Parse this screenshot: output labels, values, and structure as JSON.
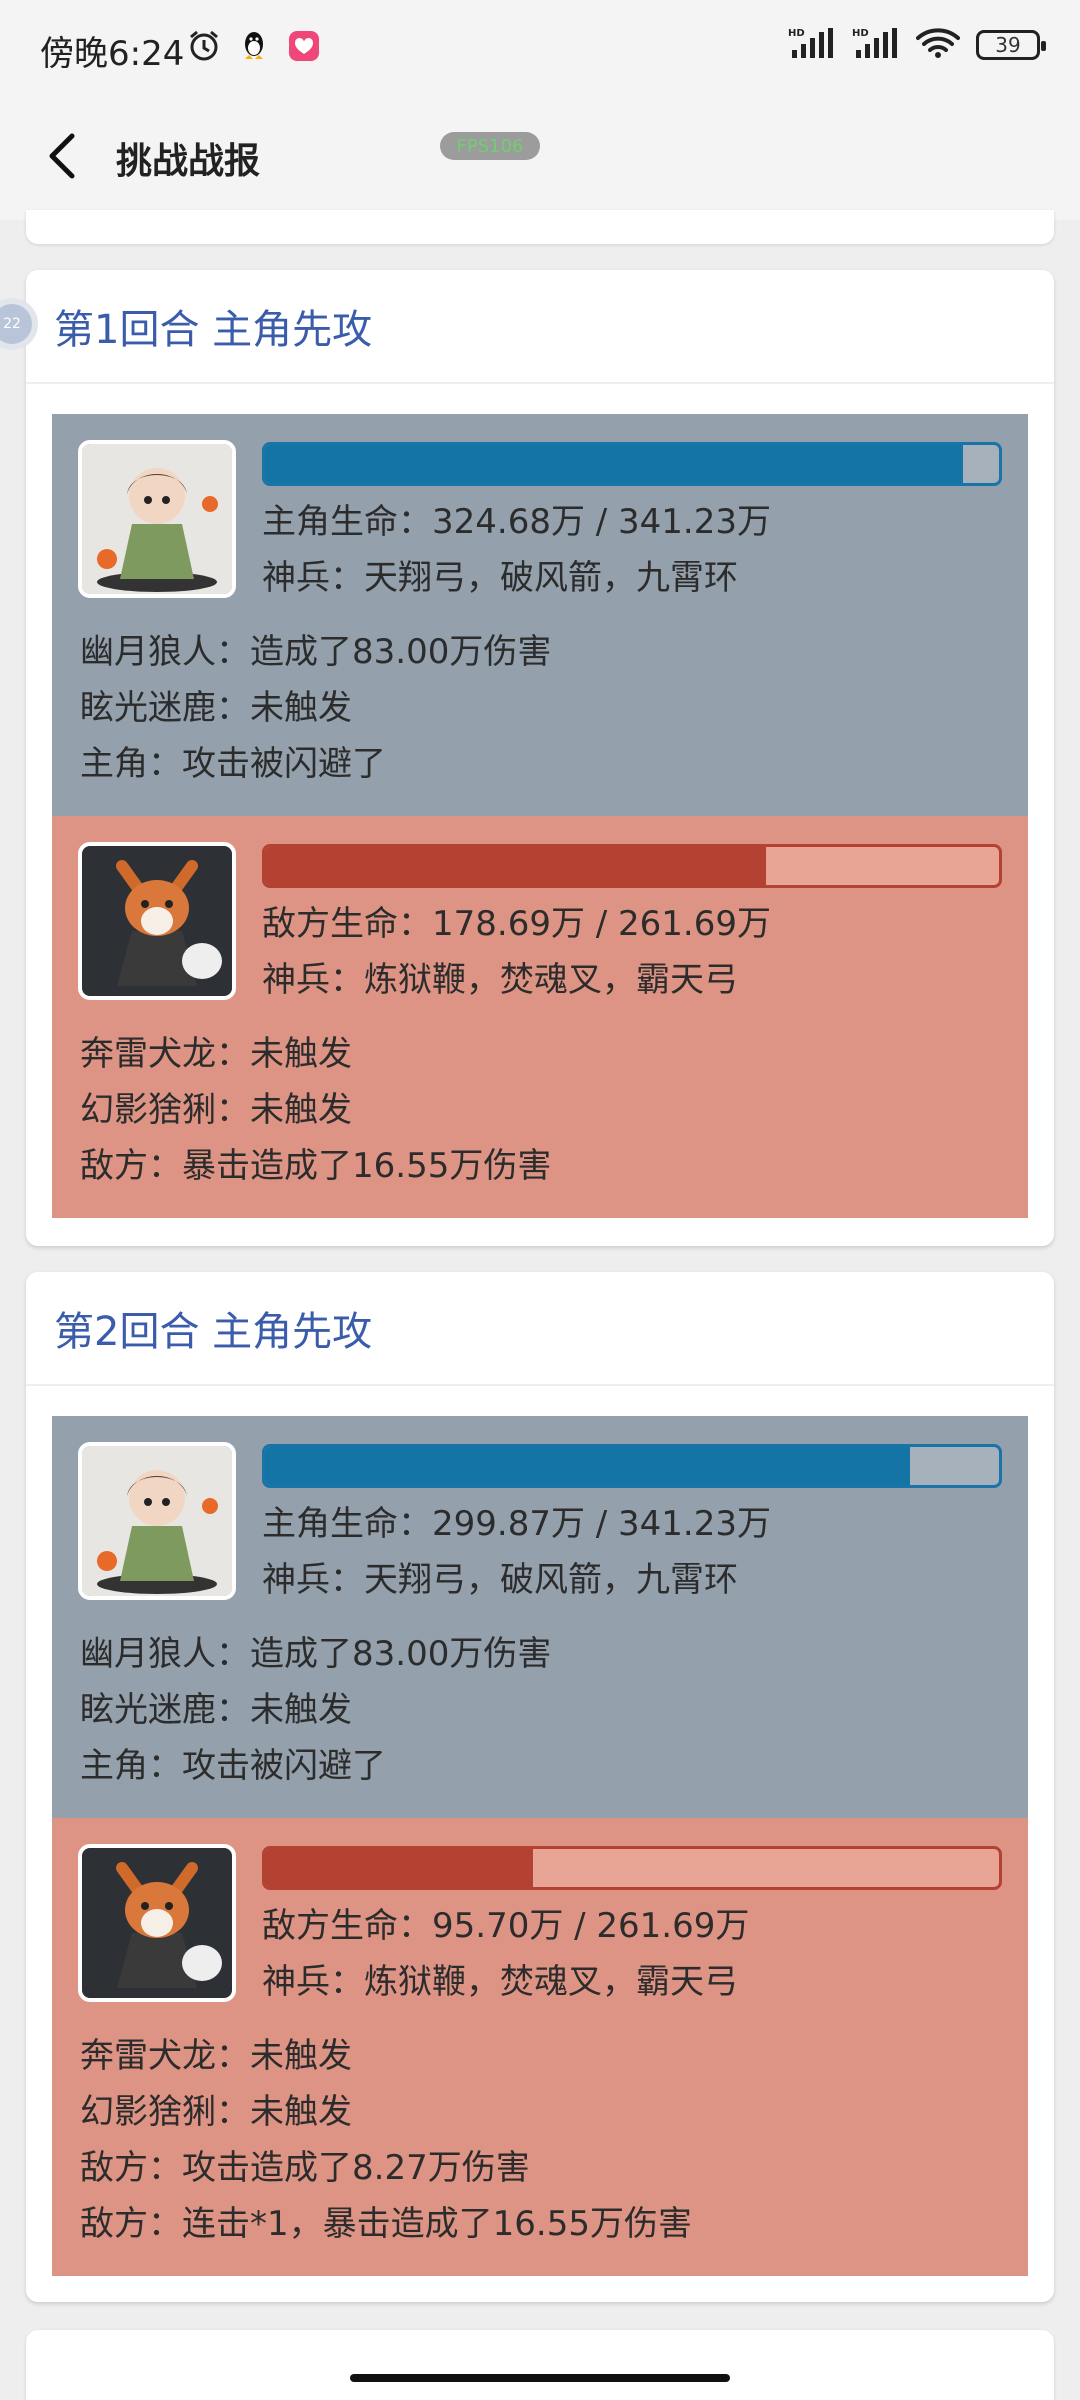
{
  "status_bar": {
    "time": "傍晚6:24",
    "battery": "39"
  },
  "header": {
    "title": "挑战战报",
    "fps_label": "FPS106"
  },
  "side_badge": "22",
  "rounds": [
    {
      "title": "第1回合 主角先攻",
      "hero": {
        "hp_text": "主角生命：324.68万 / 341.23万",
        "hp_fraction": 0.9515,
        "weapons": "神兵：天翔弓，破风箭，九霄环",
        "lines": [
          "幽月狼人：造成了83.00万伤害",
          "眩光迷鹿：未触发",
          "主角：攻击被闪避了"
        ]
      },
      "enemy": {
        "hp_text": "敌方生命：178.69万 / 261.69万",
        "hp_fraction": 0.6828,
        "weapons": "神兵：炼狱鞭，焚魂叉，霸天弓",
        "lines": [
          "奔雷犬龙：未触发",
          "幻影猞猁：未触发",
          "敌方：暴击造成了16.55万伤害"
        ]
      }
    },
    {
      "title": "第2回合 主角先攻",
      "hero": {
        "hp_text": "主角生命：299.87万 / 341.23万",
        "hp_fraction": 0.8788,
        "weapons": "神兵：天翔弓，破风箭，九霄环",
        "lines": [
          "幽月狼人：造成了83.00万伤害",
          "眩光迷鹿：未触发",
          "主角：攻击被闪避了"
        ]
      },
      "enemy": {
        "hp_text": "敌方生命：95.70万 / 261.69万",
        "hp_fraction": 0.3657,
        "weapons": "神兵：炼狱鞭，焚魂叉，霸天弓",
        "lines": [
          "奔雷犬龙：未触发",
          "幻影猞猁：未触发",
          "敌方：攻击造成了8.27万伤害",
          "敌方：连击*1，暴击造成了16.55万伤害"
        ]
      }
    }
  ],
  "colors": {
    "hero_panel": "#94a1ad",
    "enemy_panel": "#de9484",
    "hero_hp": "#1374a5",
    "enemy_hp": "#b34232",
    "round_title": "#3b5caa"
  }
}
